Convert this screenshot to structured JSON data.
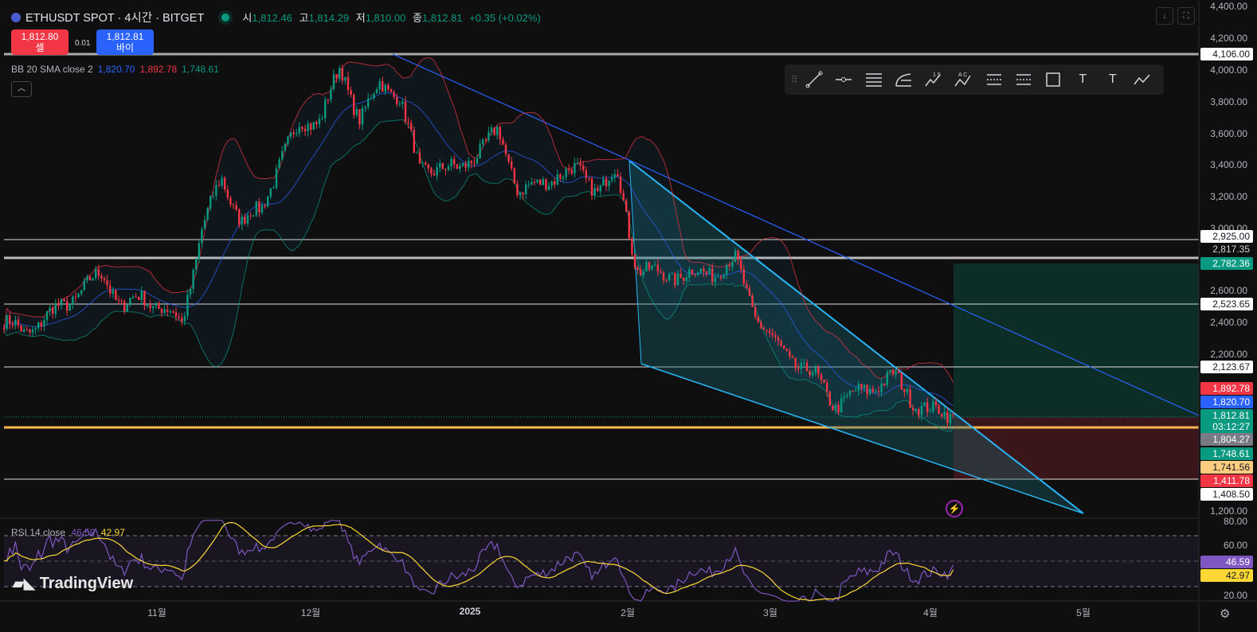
{
  "header": {
    "symbol": "ETHUSDT SPOT · 4시간 · BITGET",
    "open_label": "시",
    "open": "1,812.46",
    "high_label": "고",
    "high": "1,814.29",
    "low_label": "저",
    "low": "1,810.00",
    "close_label": "종",
    "close": "1,812.81",
    "change": "+0.35 (+0.02%)"
  },
  "trade": {
    "sell_price": "1,812.80",
    "sell_label": "셀",
    "spread": "0.01",
    "buy_price": "1,812.81",
    "buy_label": "바이"
  },
  "bb": {
    "name": "BB 20 SMA close 2",
    "basis": "1,820.70",
    "upper": "1,892.78",
    "lower": "1,748.61"
  },
  "rsi": {
    "name": "RSI 14 close",
    "rsi": "46.59",
    "ma": "42.97"
  },
  "toolbar": [
    "trend-line",
    "horizontal-ray",
    "parallel-channel",
    "fib-retracement",
    "xabcd-pattern",
    "elliott-wave",
    "long-position",
    "short-position",
    "rectangle",
    "text",
    "anchored-text",
    "path"
  ],
  "toolbar_glyphs": {
    "wave_digits": "1 5",
    "abc": "A C",
    "text": "T",
    "anchored_text": "T"
  },
  "price_axis": {
    "ticks": [
      "4,400.00",
      "4,200.00",
      "4,000.00",
      "3,800.00",
      "3,600.00",
      "3,400.00",
      "3,200.00",
      "3,000.00",
      "2,600.00",
      "2,400.00",
      "2,200.00",
      "1,200.00"
    ],
    "labels": {
      "l4106": "4,106.00",
      "l2925": "2,925.00",
      "l2817": "2,817.35",
      "l2782": "2,782.36",
      "l2523": "2,523.65",
      "l2123": "2,123.67",
      "bb_upper": "1,892.78",
      "bb_basis": "1,820.70",
      "last": "1,812.81",
      "countdown": "03:12:27",
      "l1804": "1,804.27",
      "bb_lower": "1,748.61",
      "l1741": "1,741.56",
      "l1411": "1,411.78",
      "l1408": "1,408.50"
    }
  },
  "rsi_axis": {
    "ticks": [
      "80.00",
      "60.00",
      "20.00"
    ],
    "rsi": "46.59",
    "ma": "42.97"
  },
  "time_axis": [
    "11월",
    "12월",
    "2025",
    "2월",
    "3월",
    "4월",
    "5월"
  ],
  "brand": "TradingView",
  "colors": {
    "up": "#089981",
    "down": "#f23645",
    "bb_basis": "#2962ff",
    "rsi": "#7e57c2",
    "rsi_ma": "#fdd835",
    "trend": "#2196f3"
  },
  "chart_data": {
    "type": "candlestick",
    "title": "ETHUSDT SPOT · 4시간 · BITGET",
    "ylim": [
      1200,
      4400
    ],
    "approx_closes": [
      2400,
      2330,
      2420,
      2500,
      2620,
      2700,
      2500,
      2550,
      2500,
      2380,
      3000,
      3300,
      3050,
      3100,
      3450,
      3650,
      3700,
      4000,
      3700,
      3900,
      3850,
      3350,
      3400,
      3350,
      3500,
      3600,
      3250,
      3250,
      3350,
      3350,
      3250,
      3350,
      2750,
      2700,
      2700,
      2700,
      2730,
      2780,
      2450,
      2250,
      2150,
      2050,
      1880,
      1930,
      2000,
      2050,
      1900,
      1820,
      1812.81
    ],
    "horizontal_levels": [
      4106,
      2925,
      2817.35,
      2523.65,
      2123.67,
      1741.56,
      1411.78
    ],
    "long_position": {
      "entry": 1812.81,
      "target": 2782.36,
      "stop": 1411.78
    },
    "rsi_levels": [
      70,
      50,
      30
    ]
  }
}
